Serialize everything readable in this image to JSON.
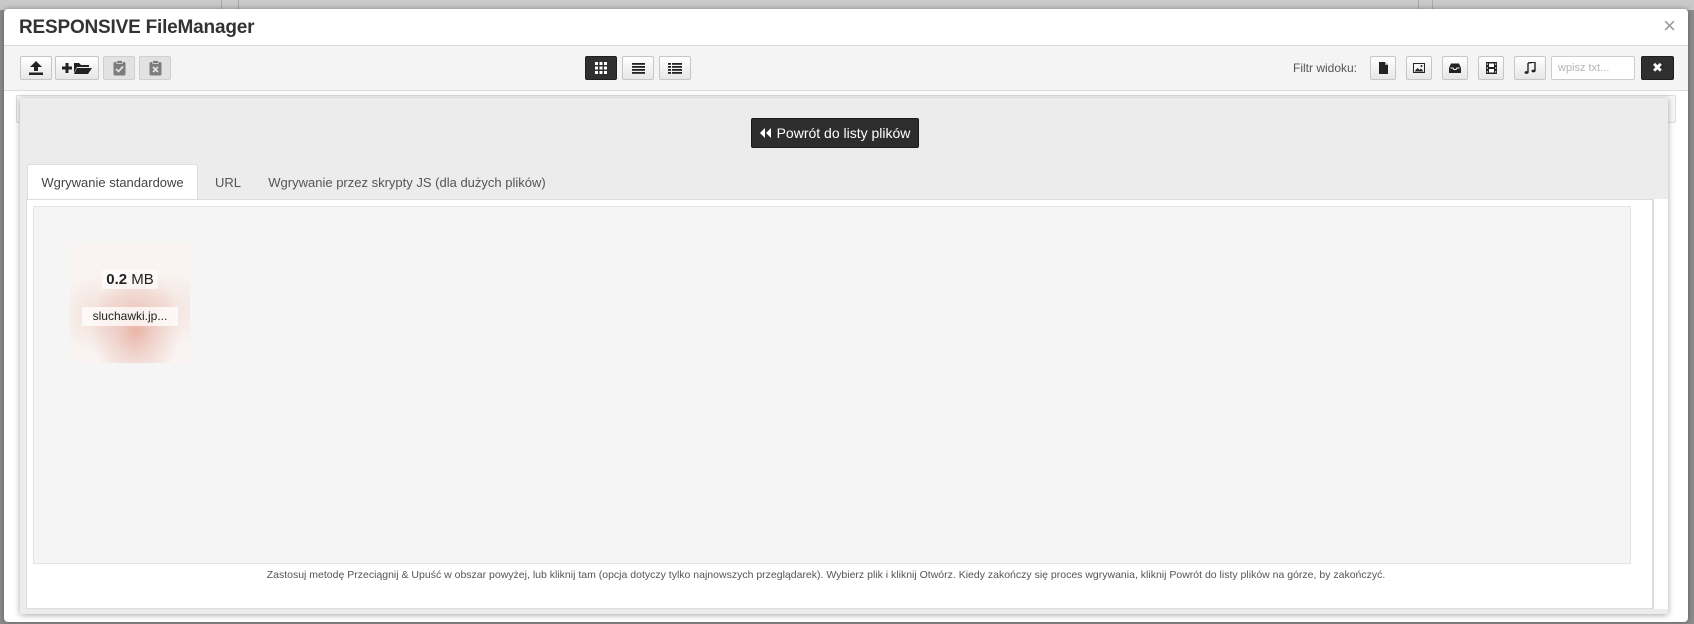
{
  "modal": {
    "title": "RESPONSIVE FileManager",
    "close_glyph": "×"
  },
  "toolbar": {
    "left_buttons": [
      {
        "name": "upload-button",
        "icon": "upload-icon",
        "enabled": true
      },
      {
        "name": "new-folder-button",
        "icon": "plus-folder-icon",
        "enabled": true
      },
      {
        "name": "paste-button",
        "icon": "clipboard-check-icon",
        "enabled": false
      },
      {
        "name": "clear-clipboard-button",
        "icon": "clipboard-x-icon",
        "enabled": false
      }
    ],
    "view_buttons": [
      {
        "name": "view-grid-button",
        "icon": "grid-icon",
        "active": true
      },
      {
        "name": "view-list-button",
        "icon": "list-icon",
        "active": false
      },
      {
        "name": "view-columns-button",
        "icon": "columns-list-icon",
        "active": false
      }
    ],
    "filter_label": "Filtr widoku:",
    "filter_buttons": [
      {
        "name": "filter-files-button",
        "icon": "file-icon"
      },
      {
        "name": "filter-images-button",
        "icon": "image-icon"
      },
      {
        "name": "filter-archives-button",
        "icon": "inbox-icon"
      },
      {
        "name": "filter-video-button",
        "icon": "film-icon"
      },
      {
        "name": "filter-music-button",
        "icon": "music-icon"
      }
    ],
    "filter_placeholder": "wpisz txt...",
    "clear_filter_glyph": "✖"
  },
  "upload": {
    "back_label": "Powrót do listy plików",
    "tabs": [
      {
        "label": "Wgrywanie standardowe",
        "active": true
      },
      {
        "label": "URL",
        "active": false
      },
      {
        "label": "Wgrywanie przez skrypty JS (dla dużych plików)",
        "active": false
      }
    ],
    "file": {
      "size_value": "0.2",
      "size_unit": "MB",
      "name": "sluchawki.jp..."
    },
    "hint": "Zastosuj metodę Przeciągnij & Upuść w obszar powyżej, lub kliknij tam (opcja dotyczy tylko najnowszych przeglądarek). Wybierz plik i kliknij Otwórz. Kiedy zakończy się proces wgrywania, kliknij Powrót do listy plików na górze, by zakończyć."
  },
  "colors": {
    "dark_button": "#2d2d2d",
    "panel_bg": "#ececec",
    "page_overlay": "#8c8c8c"
  }
}
